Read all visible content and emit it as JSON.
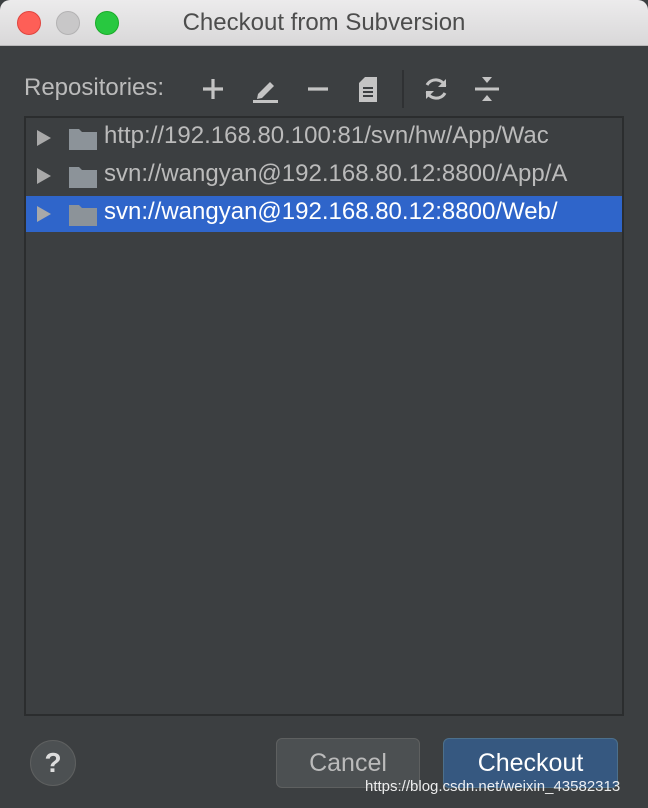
{
  "window": {
    "title": "Checkout from Subversion"
  },
  "toolbar": {
    "label": "Repositories:",
    "icons": [
      "plus-icon",
      "edit-icon",
      "minus-icon",
      "browse-icon",
      "refresh-icon",
      "collapse-all-icon"
    ]
  },
  "repositories": [
    {
      "url": "http://192.168.80.100:81/svn/hw/App/Wac",
      "selected": false
    },
    {
      "url": "svn://wangyan@192.168.80.12:8800/App/A",
      "selected": false
    },
    {
      "url": "svn://wangyan@192.168.80.12:8800/Web/",
      "selected": true
    }
  ],
  "footer": {
    "help_label": "?",
    "cancel_label": "Cancel",
    "checkout_label": "Checkout",
    "watermark": "https://blog.csdn.net/weixin_43582313"
  },
  "colors": {
    "background": "#3c3f41",
    "selection": "#2f65ca",
    "primary_button": "#365880"
  }
}
